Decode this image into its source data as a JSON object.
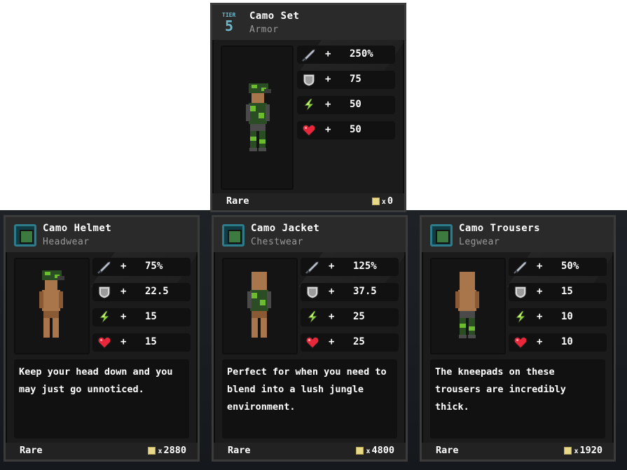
{
  "colors": {
    "skin": "#a9754a",
    "camo_dark": "#2b4d23",
    "camo_light": "#6bbd2e",
    "armor_gray": "#4a4a4a",
    "accent": "#2e7b8a"
  },
  "set_card": {
    "tier_label": "TIER",
    "tier_number": "5",
    "title": "Camo Set",
    "subtitle": "Armor",
    "stats": [
      {
        "icon": "sword-icon",
        "value": "250%"
      },
      {
        "icon": "shield-icon",
        "value": "75"
      },
      {
        "icon": "energy-bolt-icon",
        "value": "50"
      },
      {
        "icon": "heart-icon",
        "value": "50"
      }
    ],
    "plus": "+",
    "rarity": "Rare",
    "price": "0",
    "price_x": "x"
  },
  "items": [
    {
      "title": "Camo Helmet",
      "subtitle": "Headwear",
      "icon": "helmet-icon",
      "stats": [
        {
          "icon": "sword-icon",
          "value": "75%"
        },
        {
          "icon": "shield-icon",
          "value": "22.5"
        },
        {
          "icon": "energy-bolt-icon",
          "value": "15"
        },
        {
          "icon": "heart-icon",
          "value": "15"
        }
      ],
      "description": "Keep your head down and you may just go unnoticed.",
      "rarity": "Rare",
      "price": "2880"
    },
    {
      "title": "Camo Jacket",
      "subtitle": "Chestwear",
      "icon": "jacket-icon",
      "stats": [
        {
          "icon": "sword-icon",
          "value": "125%"
        },
        {
          "icon": "shield-icon",
          "value": "37.5"
        },
        {
          "icon": "energy-bolt-icon",
          "value": "25"
        },
        {
          "icon": "heart-icon",
          "value": "25"
        }
      ],
      "description": "Perfect for when you need to blend into a lush jungle environment.",
      "rarity": "Rare",
      "price": "4800"
    },
    {
      "title": "Camo Trousers",
      "subtitle": "Legwear",
      "icon": "trousers-icon",
      "stats": [
        {
          "icon": "sword-icon",
          "value": "50%"
        },
        {
          "icon": "shield-icon",
          "value": "15"
        },
        {
          "icon": "energy-bolt-icon",
          "value": "10"
        },
        {
          "icon": "heart-icon",
          "value": "10"
        }
      ],
      "description": "The kneepads on these trousers are incredibly thick.",
      "rarity": "Rare",
      "price": "1920"
    }
  ]
}
